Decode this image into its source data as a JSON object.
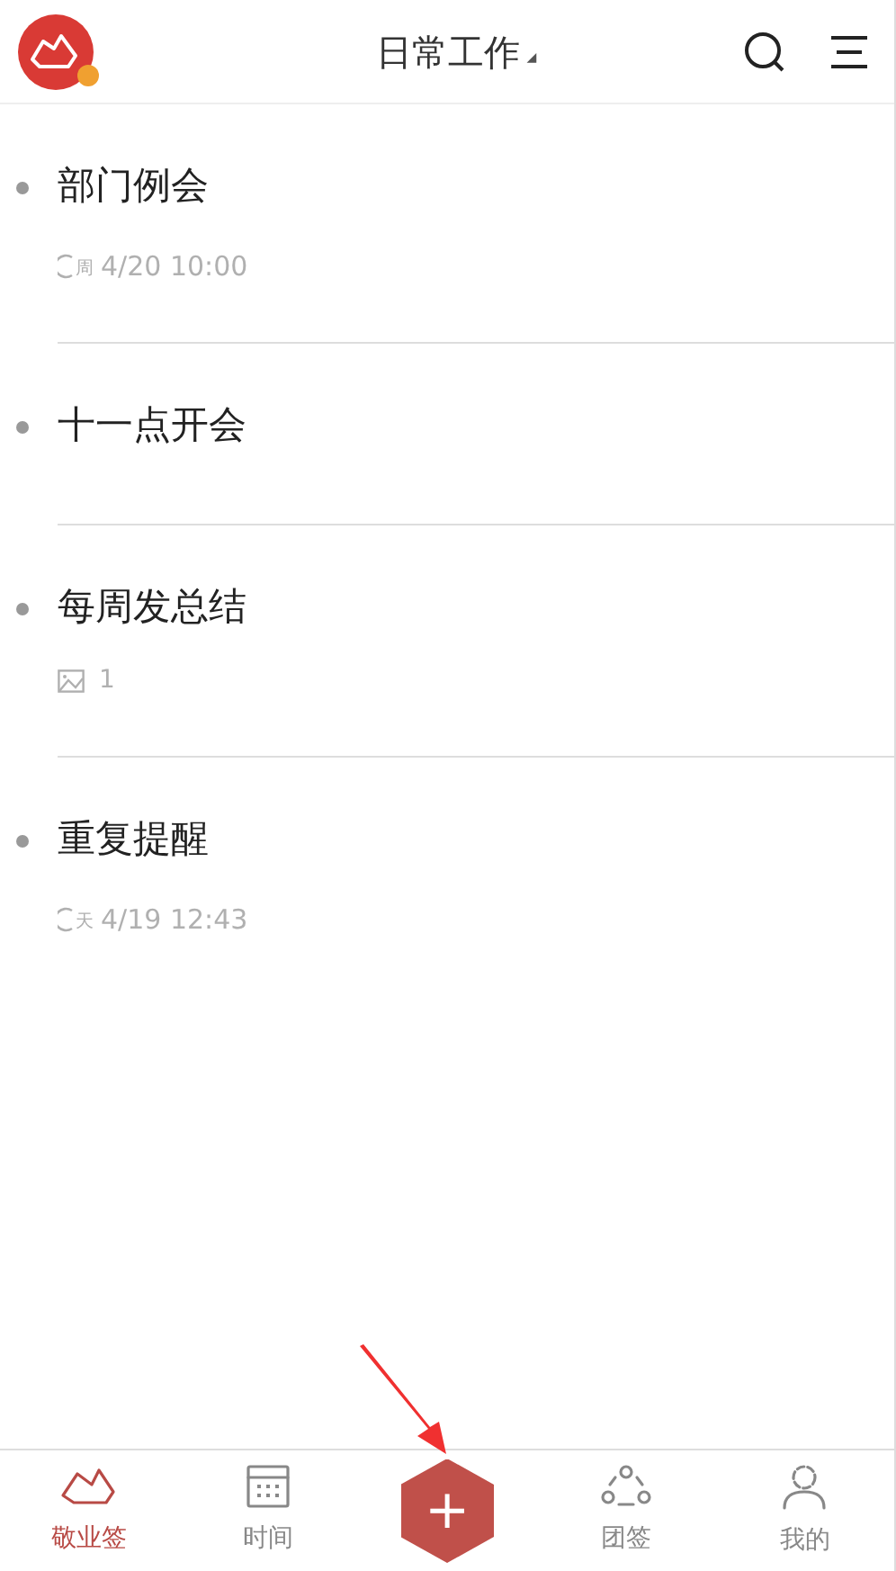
{
  "header": {
    "title": "日常工作",
    "dropdown_mark": "◢"
  },
  "notes": [
    {
      "title": "部门例会",
      "meta": {
        "kind": "repeat",
        "badge": "周",
        "text": "4/20 10:00"
      }
    },
    {
      "title": "十一点开会"
    },
    {
      "title": "每周发总结",
      "meta": {
        "kind": "image",
        "text": "1"
      }
    },
    {
      "title": "重复提醒",
      "meta": {
        "kind": "repeat",
        "badge": "天",
        "text": "4/19 12:43"
      }
    }
  ],
  "bottom_nav": [
    {
      "kind": "notes",
      "label": "敬业签",
      "selected": true
    },
    {
      "kind": "calendar",
      "label": "时间",
      "selected": false
    },
    {
      "kind": "add",
      "symbol": "+"
    },
    {
      "kind": "team",
      "label": "团签",
      "selected": false
    },
    {
      "kind": "profile",
      "label": "我的",
      "selected": false
    }
  ]
}
